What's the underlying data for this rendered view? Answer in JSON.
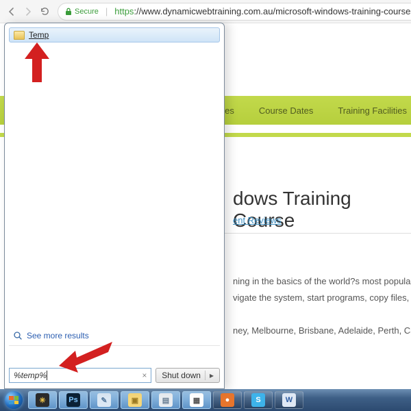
{
  "browser": {
    "secure_label": "Secure",
    "url_https": "https",
    "url_rest": "://www.dynamicwebtraining.com.au/microsoft-windows-training-courses"
  },
  "page": {
    "menu": [
      "ges",
      "Course Dates",
      "Training Facilities"
    ],
    "title": "dows Training Course",
    "reviews_link": "ent Reviews",
    "para1": "ning in the basics of the world?s most popula",
    "para2": "vigate the system, start programs, copy files, c",
    "cities": "ney, Melbourne, Brisbane, Adelaide, Perth, Ca"
  },
  "start_menu": {
    "result_label": "Temp",
    "see_more": "See more results",
    "search_value": "%temp%",
    "shutdown_label": "Shut down"
  },
  "taskbar": {
    "items": [
      {
        "name": "windows-widget",
        "bg": "#2b2b2b",
        "fg": "#f2c84b",
        "ch": "✳"
      },
      {
        "name": "photoshop",
        "bg": "#0b2136",
        "fg": "#7fc6ff",
        "ch": "Ps"
      },
      {
        "name": "notepad",
        "bg": "#dbe8f4",
        "fg": "#5a7da0",
        "ch": "✎"
      },
      {
        "name": "explorer",
        "bg": "#f6d77a",
        "fg": "#9c7a21",
        "ch": "▣"
      },
      {
        "name": "task-manager",
        "bg": "#e9edf1",
        "fg": "#6a7f94",
        "ch": "▤"
      },
      {
        "name": "calendar",
        "bg": "#ffffff",
        "fg": "#555",
        "ch": "▦"
      },
      {
        "name": "firefox",
        "bg": "#e7752c",
        "fg": "#fff",
        "ch": "●"
      },
      {
        "name": "skype",
        "bg": "#3db3ea",
        "fg": "#fff",
        "ch": "S"
      },
      {
        "name": "word",
        "bg": "#dfe8f4",
        "fg": "#2f5ea3",
        "ch": "W"
      }
    ]
  }
}
